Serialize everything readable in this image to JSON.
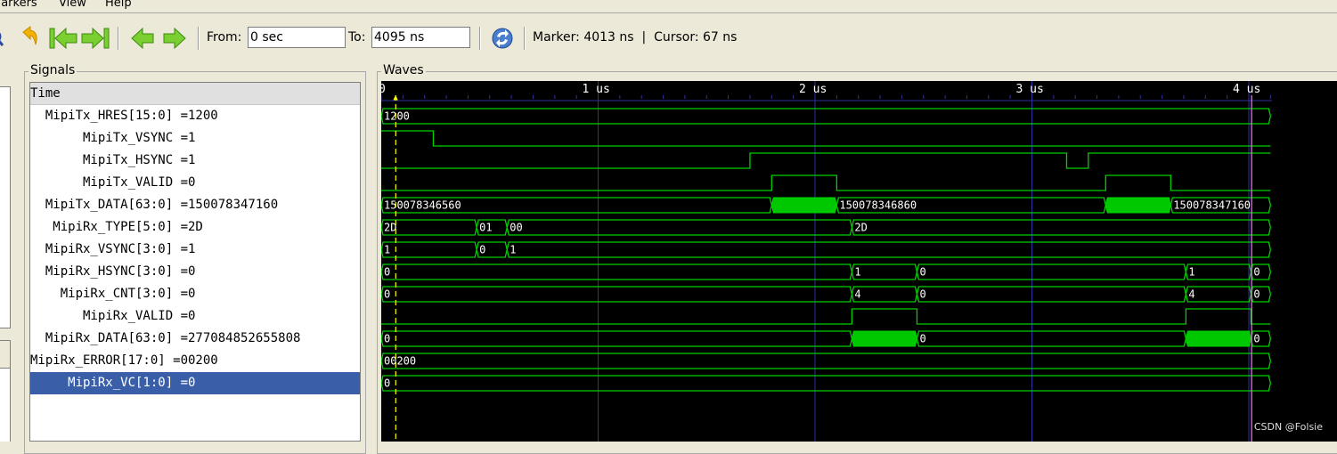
{
  "menu": [
    "Markers",
    "View",
    "Help"
  ],
  "toolbar": {
    "from_label": "From:",
    "from_value": "0 sec",
    "to_label": "To:",
    "to_value": "4095 ns",
    "status": "Marker: 4013 ns  |  Cursor: 67 ns"
  },
  "panels": {
    "signals_title": "Signals",
    "waves_title": "Waves"
  },
  "signals": [
    {
      "name": "Time",
      "label": "Time",
      "header": true
    },
    {
      "name": "MipiTx_HRES",
      "label": "  MipiTx_HRES[15:0] =1200"
    },
    {
      "name": "MipiTx_VSYNC",
      "label": "       MipiTx_VSYNC =1"
    },
    {
      "name": "MipiTx_HSYNC",
      "label": "       MipiTx_HSYNC =1"
    },
    {
      "name": "MipiTx_VALID",
      "label": "       MipiTx_VALID =0"
    },
    {
      "name": "MipiTx_DATA",
      "label": "  MipiTx_DATA[63:0] =150078347160"
    },
    {
      "name": "MipiRx_TYPE",
      "label": "   MipiRx_TYPE[5:0] =2D"
    },
    {
      "name": "MipiRx_VSYNC",
      "label": "  MipiRx_VSYNC[3:0] =1"
    },
    {
      "name": "MipiRx_HSYNC",
      "label": "  MipiRx_HSYNC[3:0] =0"
    },
    {
      "name": "MipiRx_CNT",
      "label": "    MipiRx_CNT[3:0] =0"
    },
    {
      "name": "MipiRx_VALID",
      "label": "       MipiRx_VALID =0"
    },
    {
      "name": "MipiRx_DATA",
      "label": "  MipiRx_DATA[63:0] =277084852655808"
    },
    {
      "name": "MipiRx_ERROR",
      "label": "MipiRx_ERROR[17:0] =00200"
    },
    {
      "name": "MipiRx_VC",
      "label": "     MipiRx_VC[1:0] =0",
      "selected": true
    }
  ],
  "ruler": {
    "labels": [
      "0",
      "1 us",
      "2 us",
      "3 us",
      "4 us"
    ],
    "t_end_ns": 4095
  },
  "markers": {
    "cursor_ns": 67,
    "marker_ns": 4013
  },
  "waves": [
    {
      "type": "bus",
      "segments": [
        {
          "s": 0,
          "e": 4100,
          "label": "1200"
        }
      ]
    },
    {
      "type": "bit",
      "init": 1,
      "edges": [
        {
          "t": 240,
          "v": 0
        }
      ]
    },
    {
      "type": "bit",
      "init": 0,
      "edges": [
        {
          "t": 1700,
          "v": 1
        },
        {
          "t": 3160,
          "v": 0
        },
        {
          "t": 3260,
          "v": 1
        }
      ]
    },
    {
      "type": "bit",
      "init": 0,
      "edges": [
        {
          "t": 1800,
          "v": 1
        },
        {
          "t": 2100,
          "v": 0
        },
        {
          "t": 3340,
          "v": 1
        },
        {
          "t": 3640,
          "v": 0
        }
      ]
    },
    {
      "type": "bus",
      "segments": [
        {
          "s": 0,
          "e": 1800,
          "label": "150078346560"
        },
        {
          "s": 1800,
          "e": 2100,
          "label": "",
          "busy": true
        },
        {
          "s": 2100,
          "e": 3340,
          "label": "150078346860"
        },
        {
          "s": 3340,
          "e": 3640,
          "label": "",
          "busy": true
        },
        {
          "s": 3640,
          "e": 4100,
          "label": "150078347160"
        }
      ]
    },
    {
      "type": "bus",
      "segments": [
        {
          "s": 0,
          "e": 440,
          "label": "2D"
        },
        {
          "s": 440,
          "e": 580,
          "label": "01"
        },
        {
          "s": 580,
          "e": 2170,
          "label": "00"
        },
        {
          "s": 2170,
          "e": 4100,
          "label": "2D"
        }
      ]
    },
    {
      "type": "bus",
      "segments": [
        {
          "s": 0,
          "e": 440,
          "label": "1"
        },
        {
          "s": 440,
          "e": 580,
          "label": "0"
        },
        {
          "s": 580,
          "e": 4100,
          "label": "1"
        }
      ]
    },
    {
      "type": "bus",
      "segments": [
        {
          "s": 0,
          "e": 2170,
          "label": "0"
        },
        {
          "s": 2170,
          "e": 2470,
          "label": "1"
        },
        {
          "s": 2470,
          "e": 3710,
          "label": "0"
        },
        {
          "s": 3710,
          "e": 4010,
          "label": "1"
        },
        {
          "s": 4010,
          "e": 4100,
          "label": "0"
        }
      ]
    },
    {
      "type": "bus",
      "segments": [
        {
          "s": 0,
          "e": 2170,
          "label": "0"
        },
        {
          "s": 2170,
          "e": 2470,
          "label": "4"
        },
        {
          "s": 2470,
          "e": 3710,
          "label": "0"
        },
        {
          "s": 3710,
          "e": 4010,
          "label": "4"
        },
        {
          "s": 4010,
          "e": 4100,
          "label": "0"
        }
      ]
    },
    {
      "type": "bit",
      "init": 0,
      "edges": [
        {
          "t": 2170,
          "v": 1
        },
        {
          "t": 2470,
          "v": 0
        },
        {
          "t": 3710,
          "v": 1
        },
        {
          "t": 4010,
          "v": 0
        }
      ]
    },
    {
      "type": "bus",
      "segments": [
        {
          "s": 0,
          "e": 2170,
          "label": "0"
        },
        {
          "s": 2170,
          "e": 2470,
          "label": "",
          "busy": true
        },
        {
          "s": 2470,
          "e": 3710,
          "label": "0"
        },
        {
          "s": 3710,
          "e": 4010,
          "label": "",
          "busy": true
        },
        {
          "s": 4010,
          "e": 4100,
          "label": "0"
        }
      ]
    },
    {
      "type": "bus",
      "segments": [
        {
          "s": 0,
          "e": 4100,
          "label": "00200"
        }
      ]
    },
    {
      "type": "bus",
      "segments": [
        {
          "s": 0,
          "e": 4100,
          "label": "0"
        }
      ]
    }
  ],
  "colors": {
    "wave": "#00d000",
    "busy_fill": "#00c800",
    "grid": "#3030a0",
    "cursor": "#ffff00",
    "marker": "#ff70ff",
    "selection": "#3a5fa8"
  },
  "watermark": "CSDN @Folsie"
}
